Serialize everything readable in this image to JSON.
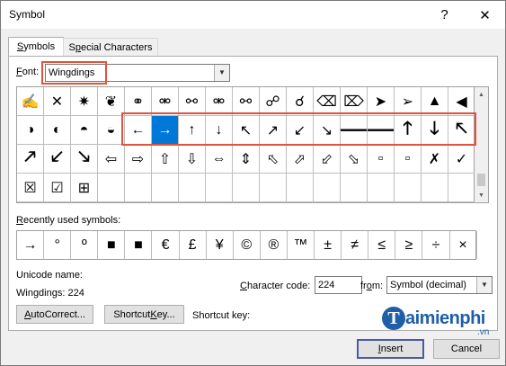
{
  "window": {
    "title": "Symbol",
    "help_label": "?",
    "close_label": "✕"
  },
  "tabs": [
    {
      "label": "Symbols",
      "underline": "S",
      "rest": "ymbols",
      "active": true
    },
    {
      "label": "Special Characters",
      "pre": "S",
      "underline": "p",
      "rest": "ecial Characters",
      "active": false
    }
  ],
  "font": {
    "label_pre": "",
    "label_u": "F",
    "label_rest": "ont:",
    "value": "Wingdings"
  },
  "symbol_grid": [
    [
      "✍",
      "✕",
      "✷",
      "❦",
      "⚭",
      "⚮",
      "⚯",
      "⚮",
      "⚯",
      "☍",
      "☌",
      "⌫",
      "⌦",
      "➤",
      "➢",
      "▲",
      "◀"
    ],
    [
      "◑",
      "◐",
      "◓",
      "◒",
      "←",
      "→",
      "↑",
      "↓",
      "↖",
      "↗",
      "↙",
      "↘",
      "🡐",
      "🡒",
      "🡑",
      "🡓",
      "🡔"
    ],
    [
      "🡕",
      "🡗",
      "🡖",
      "⇦",
      "⇨",
      "⇧",
      "⇩",
      "⇔",
      "⇕",
      "⬁",
      "⬀",
      "⬃",
      "⬂",
      "▫",
      "▫",
      "✗",
      "✓"
    ],
    [
      "☒",
      "☑",
      "⊞",
      "",
      "",
      "",
      "",
      "",
      "",
      "",
      "",
      "",
      "",
      "",
      "",
      "",
      ""
    ]
  ],
  "selected_symbol": "→",
  "recent": {
    "label": "Recently used symbols:",
    "u": "R",
    "rest": "ecently used symbols:",
    "symbols": [
      "→",
      "°",
      "º",
      "■",
      "■",
      "€",
      "£",
      "¥",
      "©",
      "®",
      "™",
      "±",
      "≠",
      "≤",
      "≥",
      "÷",
      "×"
    ]
  },
  "unicode": {
    "name_label": "Unicode name:",
    "name_value": "Wingdings: 224"
  },
  "char_code": {
    "label_u": "C",
    "label_rest": "haracter code:",
    "value": "224",
    "from_pre": "fr",
    "from_u": "o",
    "from_rest": "m:",
    "from_value": "Symbol (decimal)"
  },
  "buttons": {
    "autocorrect": {
      "u": "A",
      "rest": "utoCorrect..."
    },
    "shortcut_key": {
      "pre": "Shortcut ",
      "u": "K",
      "rest": "ey..."
    },
    "shortcut_key_label": "Shortcut key:",
    "insert": {
      "u": "I",
      "rest": "nsert"
    },
    "cancel": "Cancel"
  },
  "watermark": {
    "letter": "T",
    "text": "aimienphi",
    "suffix": ".vn"
  },
  "colors": {
    "selection": "#0078d7",
    "annotation": "#e0533d",
    "watermark": "#1f5fa8"
  }
}
